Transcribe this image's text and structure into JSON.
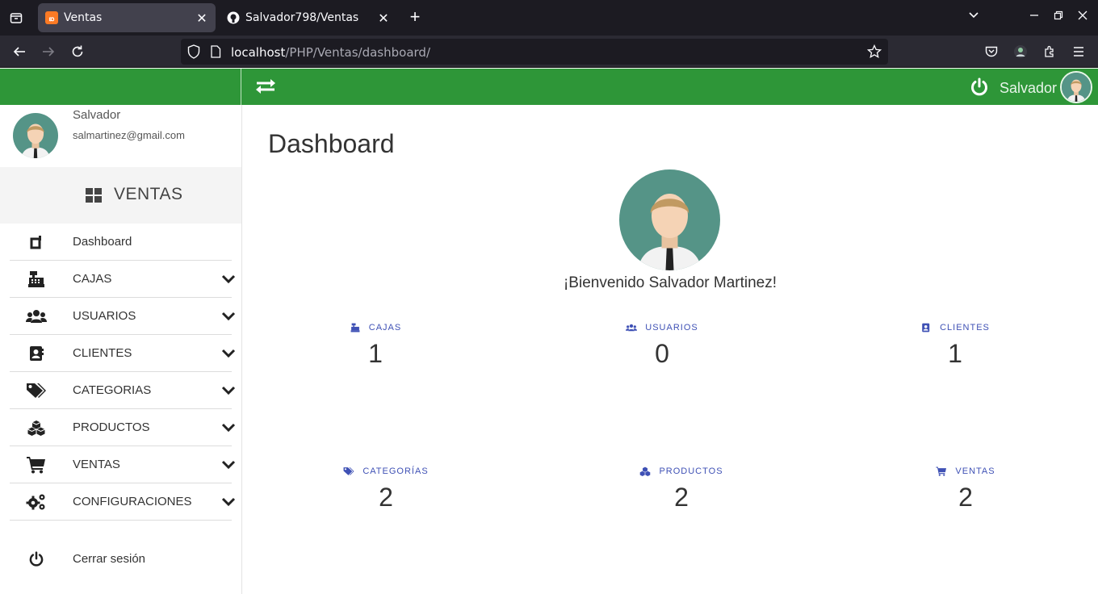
{
  "browser": {
    "tabs": [
      {
        "title": "Ventas",
        "active": true
      },
      {
        "title": "Salvador798/Ventas",
        "active": false
      }
    ],
    "url_host": "localhost",
    "url_path": "/PHP/Ventas/dashboard/"
  },
  "topbar": {
    "username": "Salvador",
    "accent": "#2e9638"
  },
  "sidebar": {
    "profile": {
      "name": "Salvador",
      "email": "salmartinez@gmail.com"
    },
    "brand": "VENTAS",
    "items": [
      {
        "label": "Dashboard",
        "icon": "dashboard-icon",
        "expandable": false
      },
      {
        "label": "CAJAS",
        "icon": "cash-register-icon",
        "expandable": true
      },
      {
        "label": "USUARIOS",
        "icon": "users-icon",
        "expandable": true
      },
      {
        "label": "CLIENTES",
        "icon": "address-book-icon",
        "expandable": true
      },
      {
        "label": "CATEGORIAS",
        "icon": "tags-icon",
        "expandable": true
      },
      {
        "label": "PRODUCTOS",
        "icon": "cubes-icon",
        "expandable": true
      },
      {
        "label": "VENTAS",
        "icon": "cart-icon",
        "expandable": true
      },
      {
        "label": "CONFIGURACIONES",
        "icon": "cogs-icon",
        "expandable": true
      }
    ],
    "logout": "Cerrar sesión"
  },
  "main": {
    "title": "Dashboard",
    "welcome": "¡Bienvenido Salvador Martinez!",
    "stats": [
      {
        "label": "CAJAS",
        "value": "1",
        "icon": "cash-register-icon"
      },
      {
        "label": "USUARIOS",
        "value": "0",
        "icon": "users-icon"
      },
      {
        "label": "CLIENTES",
        "value": "1",
        "icon": "address-book-icon"
      },
      {
        "label": "CATEGORÍAS",
        "value": "2",
        "icon": "tags-icon"
      },
      {
        "label": "PRODUCTOS",
        "value": "2",
        "icon": "cubes-icon"
      },
      {
        "label": "VENTAS",
        "value": "2",
        "icon": "cart-icon"
      }
    ],
    "stat_color": "#3f51b5"
  }
}
